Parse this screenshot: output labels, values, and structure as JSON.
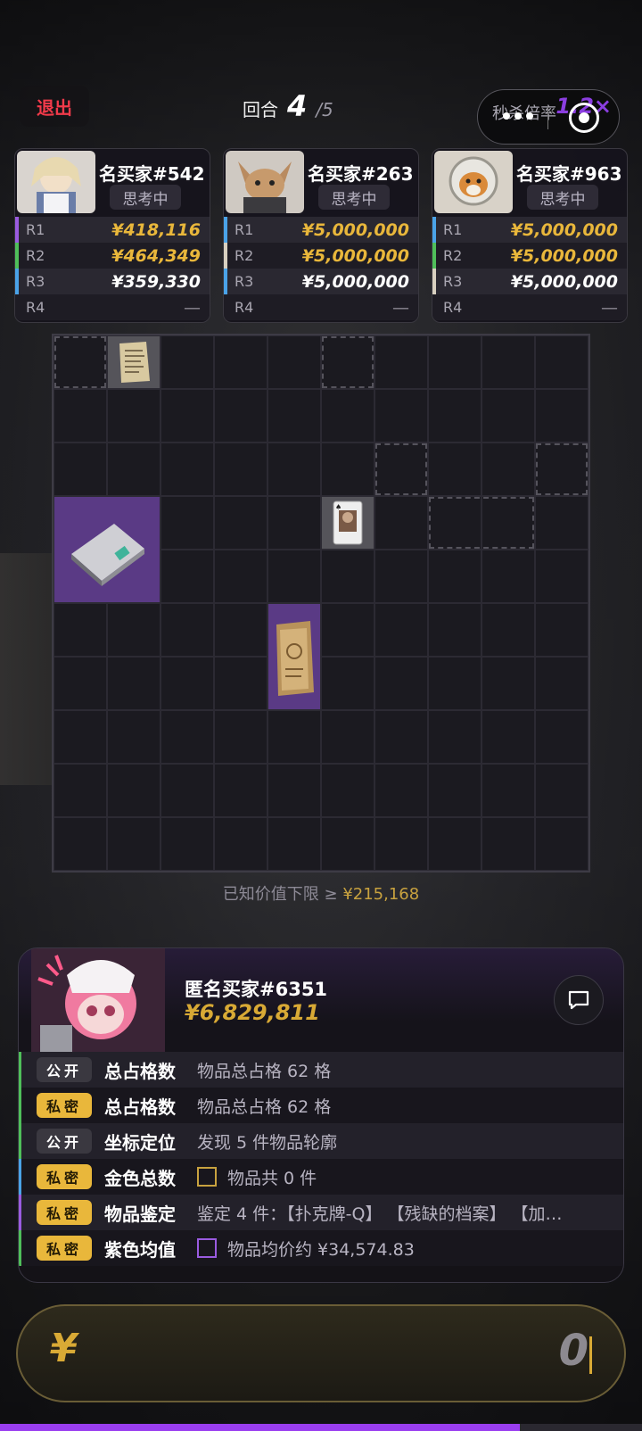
{
  "topbar": {
    "exit_label": "退出",
    "round_label": "回合",
    "round_current": "4",
    "round_total": "/5",
    "kill_label": "秒杀倍率",
    "kill_multiplier": "1.2×"
  },
  "opponents": [
    {
      "name": "名买家#542",
      "status": "思考中",
      "rows": [
        {
          "label": "R1",
          "value": "¥418,116",
          "value_color": "#e9b73b",
          "bar_color": "#9a5be0"
        },
        {
          "label": "R2",
          "value": "¥464,349",
          "value_color": "#e9b73b",
          "bar_color": "#4fbf5a"
        },
        {
          "label": "R3",
          "value": "¥359,330",
          "value_color": "#ffffff",
          "bar_color": "#4aa3e8"
        },
        {
          "label": "R4",
          "value": "—",
          "value_color": "#8a8792",
          "bar_color": ""
        }
      ]
    },
    {
      "name": "名买家#263",
      "status": "思考中",
      "rows": [
        {
          "label": "R1",
          "value": "¥5,000,000",
          "value_color": "#e9b73b",
          "bar_color": "#4aa3e8"
        },
        {
          "label": "R2",
          "value": "¥5,000,000",
          "value_color": "#e9b73b",
          "bar_color": "#d8d0c0"
        },
        {
          "label": "R3",
          "value": "¥5,000,000",
          "value_color": "#ffffff",
          "bar_color": "#4aa3e8"
        },
        {
          "label": "R4",
          "value": "—",
          "value_color": "#8a8792",
          "bar_color": ""
        }
      ]
    },
    {
      "name": "名买家#963",
      "status": "思考中",
      "rows": [
        {
          "label": "R1",
          "value": "¥5,000,000",
          "value_color": "#e9b73b",
          "bar_color": "#4aa3e8"
        },
        {
          "label": "R2",
          "value": "¥5,000,000",
          "value_color": "#e9b73b",
          "bar_color": "#4fbf5a"
        },
        {
          "label": "R3",
          "value": "¥5,000,000",
          "value_color": "#ffffff",
          "bar_color": "#d8d0c0"
        },
        {
          "label": "R4",
          "value": "—",
          "value_color": "#8a8792",
          "bar_color": ""
        }
      ]
    }
  ],
  "known_value": {
    "prefix": "已知价值下限 ≥ ",
    "value": "¥215,168"
  },
  "player": {
    "name": "匿名买家#6351",
    "money": "¥6,829,811"
  },
  "clues": [
    {
      "tag": "公开",
      "tag_type": "public",
      "title": "总占格数",
      "text": "物品总占格 62 格",
      "bar_color": "#4fbf5a",
      "box_color": ""
    },
    {
      "tag": "私密",
      "tag_type": "private",
      "title": "总占格数",
      "text": "物品总占格 62 格",
      "bar_color": "#4fbf5a",
      "box_color": ""
    },
    {
      "tag": "公开",
      "tag_type": "public",
      "title": "坐标定位",
      "text": "发现 5 件物品轮廓",
      "bar_color": "#4fbf5a",
      "box_color": ""
    },
    {
      "tag": "私密",
      "tag_type": "private",
      "title": "金色总数",
      "text": "物品共 0 件",
      "bar_color": "#4aa3e8",
      "box_color": "#c8a23f"
    },
    {
      "tag": "私密",
      "tag_type": "private",
      "title": "物品鉴定",
      "text": "鉴定 4 件：【扑克牌-Q】 【残缺的档案】 【加…",
      "bar_color": "#9a5be0",
      "box_color": ""
    },
    {
      "tag": "私密",
      "tag_type": "private",
      "title": "紫色均值",
      "text": "物品均价约 ¥34,574.83",
      "bar_color": "#4fbf5a",
      "box_color": "#9a5be0"
    }
  ],
  "bid": {
    "currency": "¥",
    "value": "0"
  },
  "progress_fraction": 0.81,
  "icons": [
    "more-icon",
    "target-icon",
    "chat-icon"
  ]
}
